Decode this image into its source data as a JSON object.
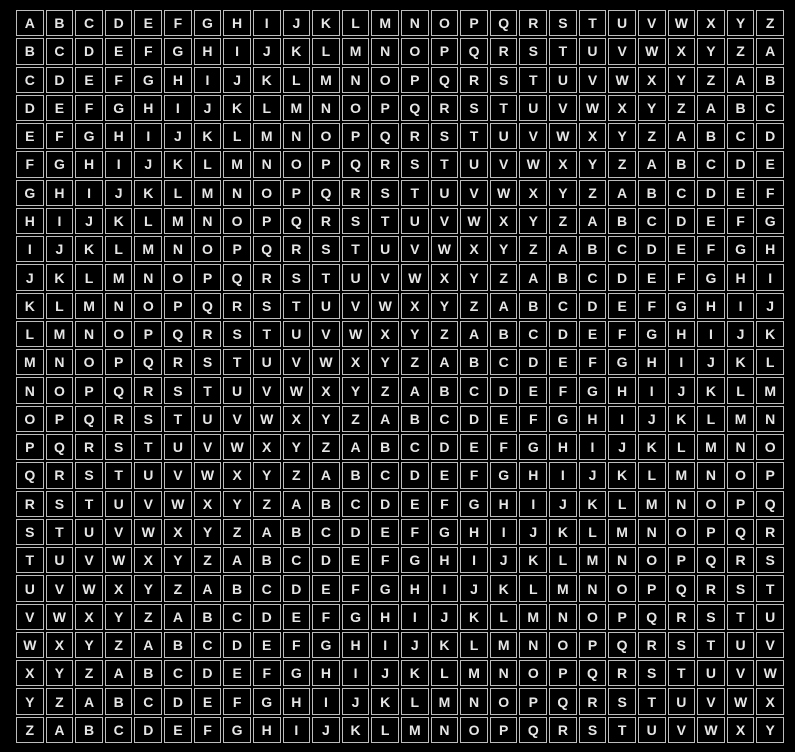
{
  "table": {
    "rows": [
      [
        "A",
        "B",
        "C",
        "D",
        "E",
        "F",
        "G",
        "H",
        "I",
        "J",
        "K",
        "L",
        "M",
        "N",
        "O",
        "P",
        "Q",
        "R",
        "S",
        "T",
        "U",
        "V",
        "W",
        "X",
        "Y",
        "Z"
      ],
      [
        "B",
        "C",
        "D",
        "E",
        "F",
        "G",
        "H",
        "I",
        "J",
        "K",
        "L",
        "M",
        "N",
        "O",
        "P",
        "Q",
        "R",
        "S",
        "T",
        "U",
        "V",
        "W",
        "X",
        "Y",
        "Z",
        "A"
      ],
      [
        "C",
        "D",
        "E",
        "F",
        "G",
        "H",
        "I",
        "J",
        "K",
        "L",
        "M",
        "N",
        "O",
        "P",
        "Q",
        "R",
        "S",
        "T",
        "U",
        "V",
        "W",
        "X",
        "Y",
        "Z",
        "A",
        "B"
      ],
      [
        "D",
        "E",
        "F",
        "G",
        "H",
        "I",
        "J",
        "K",
        "L",
        "M",
        "N",
        "O",
        "P",
        "Q",
        "R",
        "S",
        "T",
        "U",
        "V",
        "W",
        "X",
        "Y",
        "Z",
        "A",
        "B",
        "C"
      ],
      [
        "E",
        "F",
        "G",
        "H",
        "I",
        "J",
        "K",
        "L",
        "M",
        "N",
        "O",
        "P",
        "Q",
        "R",
        "S",
        "T",
        "U",
        "V",
        "W",
        "X",
        "Y",
        "Z",
        "A",
        "B",
        "C",
        "D"
      ],
      [
        "F",
        "G",
        "H",
        "I",
        "J",
        "K",
        "L",
        "M",
        "N",
        "O",
        "P",
        "Q",
        "R",
        "S",
        "T",
        "U",
        "V",
        "W",
        "X",
        "Y",
        "Z",
        "A",
        "B",
        "C",
        "D",
        "E"
      ],
      [
        "G",
        "H",
        "I",
        "J",
        "K",
        "L",
        "M",
        "N",
        "O",
        "P",
        "Q",
        "R",
        "S",
        "T",
        "U",
        "V",
        "W",
        "X",
        "Y",
        "Z",
        "A",
        "B",
        "C",
        "D",
        "E",
        "F"
      ],
      [
        "H",
        "I",
        "J",
        "K",
        "L",
        "M",
        "N",
        "O",
        "P",
        "Q",
        "R",
        "S",
        "T",
        "U",
        "V",
        "W",
        "X",
        "Y",
        "Z",
        "A",
        "B",
        "C",
        "D",
        "E",
        "F",
        "G"
      ],
      [
        "I",
        "J",
        "K",
        "L",
        "M",
        "N",
        "O",
        "P",
        "Q",
        "R",
        "S",
        "T",
        "U",
        "V",
        "W",
        "X",
        "Y",
        "Z",
        "A",
        "B",
        "C",
        "D",
        "E",
        "F",
        "G",
        "H"
      ],
      [
        "J",
        "K",
        "L",
        "M",
        "N",
        "O",
        "P",
        "Q",
        "R",
        "S",
        "T",
        "U",
        "V",
        "W",
        "X",
        "Y",
        "Z",
        "A",
        "B",
        "C",
        "D",
        "E",
        "F",
        "G",
        "H",
        "I"
      ],
      [
        "K",
        "L",
        "M",
        "N",
        "O",
        "P",
        "Q",
        "R",
        "S",
        "T",
        "U",
        "V",
        "W",
        "X",
        "Y",
        "Z",
        "A",
        "B",
        "C",
        "D",
        "E",
        "F",
        "G",
        "H",
        "I",
        "J"
      ],
      [
        "L",
        "M",
        "N",
        "O",
        "P",
        "Q",
        "R",
        "S",
        "T",
        "U",
        "V",
        "W",
        "X",
        "Y",
        "Z",
        "A",
        "B",
        "C",
        "D",
        "E",
        "F",
        "G",
        "H",
        "I",
        "J",
        "K"
      ],
      [
        "M",
        "N",
        "O",
        "P",
        "Q",
        "R",
        "S",
        "T",
        "U",
        "V",
        "W",
        "X",
        "Y",
        "Z",
        "A",
        "B",
        "C",
        "D",
        "E",
        "F",
        "G",
        "H",
        "I",
        "J",
        "K",
        "L"
      ],
      [
        "N",
        "O",
        "P",
        "Q",
        "R",
        "S",
        "T",
        "U",
        "V",
        "W",
        "X",
        "Y",
        "Z",
        "A",
        "B",
        "C",
        "D",
        "E",
        "F",
        "G",
        "H",
        "I",
        "J",
        "K",
        "L",
        "M"
      ],
      [
        "O",
        "P",
        "Q",
        "R",
        "S",
        "T",
        "U",
        "V",
        "W",
        "X",
        "Y",
        "Z",
        "A",
        "B",
        "C",
        "D",
        "E",
        "F",
        "G",
        "H",
        "I",
        "J",
        "K",
        "L",
        "M",
        "N"
      ],
      [
        "P",
        "Q",
        "R",
        "S",
        "T",
        "U",
        "V",
        "W",
        "X",
        "Y",
        "Z",
        "A",
        "B",
        "C",
        "D",
        "E",
        "F",
        "G",
        "H",
        "I",
        "J",
        "K",
        "L",
        "M",
        "N",
        "O"
      ],
      [
        "Q",
        "R",
        "S",
        "T",
        "U",
        "V",
        "W",
        "X",
        "Y",
        "Z",
        "A",
        "B",
        "C",
        "D",
        "E",
        "F",
        "G",
        "H",
        "I",
        "J",
        "K",
        "L",
        "M",
        "N",
        "O",
        "P"
      ],
      [
        "R",
        "S",
        "T",
        "U",
        "V",
        "W",
        "X",
        "Y",
        "Z",
        "A",
        "B",
        "C",
        "D",
        "E",
        "F",
        "G",
        "H",
        "I",
        "J",
        "K",
        "L",
        "M",
        "N",
        "O",
        "P",
        "Q"
      ],
      [
        "S",
        "T",
        "U",
        "V",
        "W",
        "X",
        "Y",
        "Z",
        "A",
        "B",
        "C",
        "D",
        "E",
        "F",
        "G",
        "H",
        "I",
        "J",
        "K",
        "L",
        "M",
        "N",
        "O",
        "P",
        "Q",
        "R"
      ],
      [
        "T",
        "U",
        "V",
        "W",
        "X",
        "Y",
        "Z",
        "A",
        "B",
        "C",
        "D",
        "E",
        "F",
        "G",
        "H",
        "I",
        "J",
        "K",
        "L",
        "M",
        "N",
        "O",
        "P",
        "Q",
        "R",
        "S"
      ],
      [
        "U",
        "V",
        "W",
        "X",
        "Y",
        "Z",
        "A",
        "B",
        "C",
        "D",
        "E",
        "F",
        "G",
        "H",
        "I",
        "J",
        "K",
        "L",
        "M",
        "N",
        "O",
        "P",
        "Q",
        "R",
        "S",
        "T"
      ],
      [
        "V",
        "W",
        "X",
        "Y",
        "Z",
        "A",
        "B",
        "C",
        "D",
        "E",
        "F",
        "G",
        "H",
        "I",
        "J",
        "K",
        "L",
        "M",
        "N",
        "O",
        "P",
        "Q",
        "R",
        "S",
        "T",
        "U"
      ],
      [
        "W",
        "X",
        "Y",
        "Z",
        "A",
        "B",
        "C",
        "D",
        "E",
        "F",
        "G",
        "H",
        "I",
        "J",
        "K",
        "L",
        "M",
        "N",
        "O",
        "P",
        "Q",
        "R",
        "S",
        "T",
        "U",
        "V"
      ],
      [
        "X",
        "Y",
        "Z",
        "A",
        "B",
        "C",
        "D",
        "E",
        "F",
        "G",
        "H",
        "I",
        "J",
        "K",
        "L",
        "M",
        "N",
        "O",
        "P",
        "Q",
        "R",
        "S",
        "T",
        "U",
        "V",
        "W"
      ],
      [
        "Y",
        "Z",
        "A",
        "B",
        "C",
        "D",
        "E",
        "F",
        "G",
        "H",
        "I",
        "J",
        "K",
        "L",
        "M",
        "N",
        "O",
        "P",
        "Q",
        "R",
        "S",
        "T",
        "U",
        "V",
        "W",
        "X"
      ],
      [
        "Z",
        "A",
        "B",
        "C",
        "D",
        "E",
        "F",
        "G",
        "H",
        "I",
        "J",
        "K",
        "L",
        "M",
        "N",
        "O",
        "P",
        "Q",
        "R",
        "S",
        "T",
        "U",
        "V",
        "W",
        "X",
        "Y"
      ]
    ]
  },
  "colors": {
    "background": "#000000",
    "cell_border": "#bdbdbd",
    "letter": "#e6e6e6"
  }
}
